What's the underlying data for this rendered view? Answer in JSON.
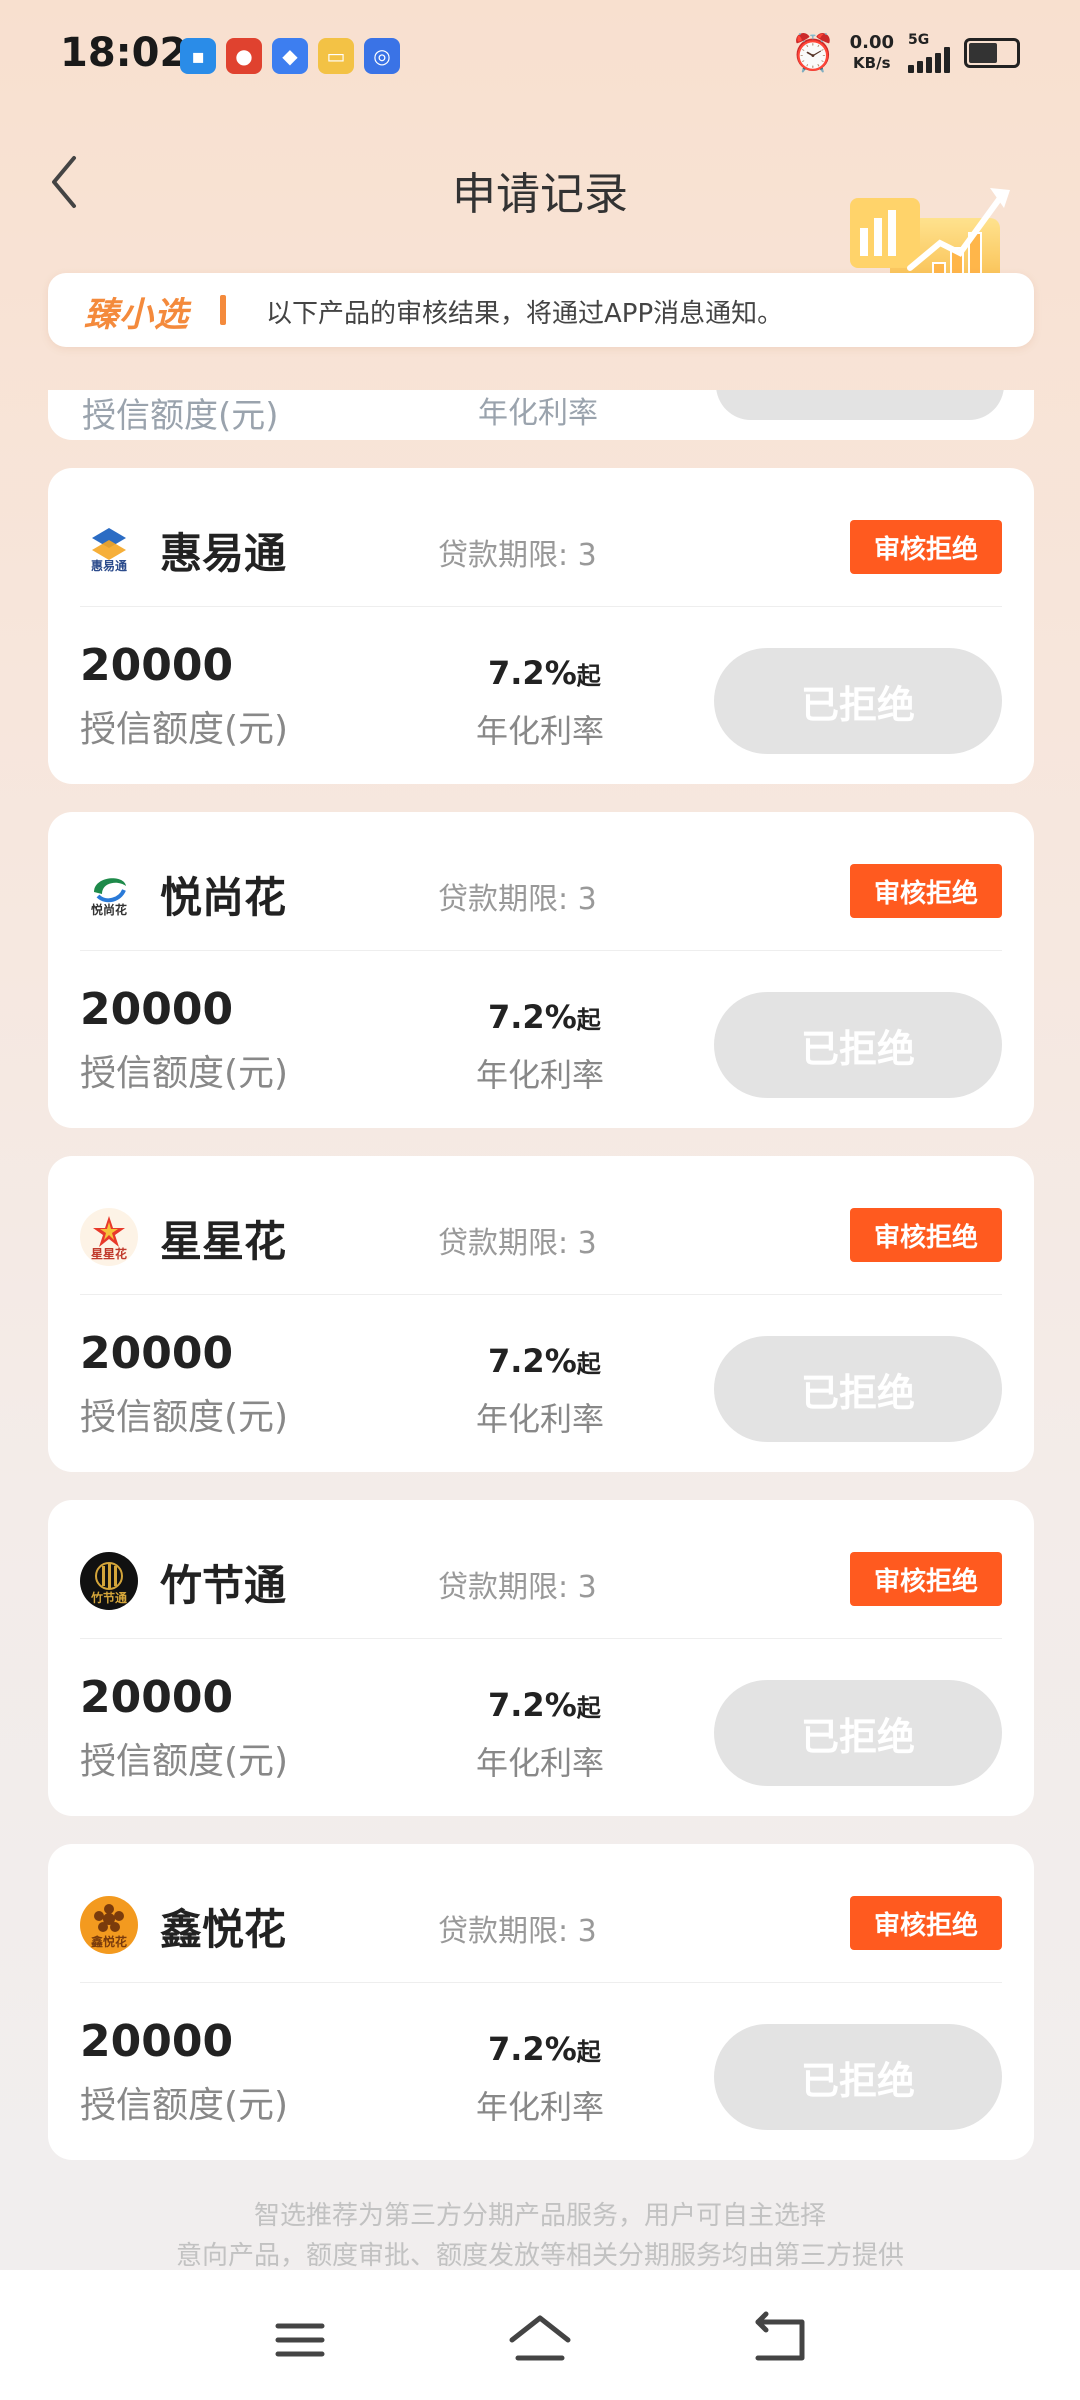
{
  "status_bar": {
    "time": "18:02",
    "net_speed_value": "0.00",
    "net_speed_unit": "KB/s",
    "signal_label": "5G"
  },
  "header": {
    "title": "申请记录"
  },
  "notice": {
    "brand": "臻小选",
    "text": "以下产品的审核结果，将通过APP消息通知。"
  },
  "partial_card": {
    "amount_label": "授信额度(元)",
    "rate_label": "年化利率"
  },
  "cards": [
    {
      "name": "惠易通",
      "logo_text": "惠易通",
      "term": "贷款期限: 3",
      "status": "审核拒绝",
      "amount": "20000",
      "amount_label": "授信额度(元)",
      "rate_value": "7.2%",
      "rate_suffix": "起",
      "rate_label": "年化利率",
      "action": "已拒绝"
    },
    {
      "name": "悦尚花",
      "logo_text": "悦尚花",
      "term": "贷款期限: 3",
      "status": "审核拒绝",
      "amount": "20000",
      "amount_label": "授信额度(元)",
      "rate_value": "7.2%",
      "rate_suffix": "起",
      "rate_label": "年化利率",
      "action": "已拒绝"
    },
    {
      "name": "星星花",
      "logo_text": "星星花",
      "term": "贷款期限: 3",
      "status": "审核拒绝",
      "amount": "20000",
      "amount_label": "授信额度(元)",
      "rate_value": "7.2%",
      "rate_suffix": "起",
      "rate_label": "年化利率",
      "action": "已拒绝"
    },
    {
      "name": "竹节通",
      "logo_text": "竹节通",
      "term": "贷款期限: 3",
      "status": "审核拒绝",
      "amount": "20000",
      "amount_label": "授信额度(元)",
      "rate_value": "7.2%",
      "rate_suffix": "起",
      "rate_label": "年化利率",
      "action": "已拒绝"
    },
    {
      "name": "鑫悦花",
      "logo_text": "鑫悦花",
      "term": "贷款期限: 3",
      "status": "审核拒绝",
      "amount": "20000",
      "amount_label": "授信额度(元)",
      "rate_value": "7.2%",
      "rate_suffix": "起",
      "rate_label": "年化利率",
      "action": "已拒绝"
    }
  ],
  "disclaimer": {
    "line1": "智选推荐为第三方分期产品服务，用户可自主选择",
    "line2": "意向产品，额度审批、额度发放等相关分期服务均由第三方提供"
  },
  "colors": {
    "status_badge": "#ff5a1f",
    "brand_orange": "#f48a3c",
    "disabled_button": "#e3e3e3"
  },
  "icons": {
    "back": "chevron-left-icon",
    "menu": "menu-icon",
    "home": "home-icon",
    "return": "return-icon",
    "alarm": "alarm-icon",
    "battery": "battery-icon"
  }
}
